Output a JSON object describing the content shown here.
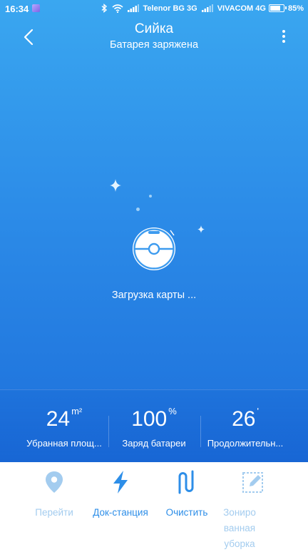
{
  "status_bar": {
    "time": "16:34",
    "carrier1": "Telenor BG 3G",
    "carrier2": "VIVACOM 4G",
    "battery": "85%",
    "battery_level": 0.85
  },
  "header": {
    "title": "Сийка",
    "subtitle": "Батарея заряжена"
  },
  "map": {
    "loading_text": "Загрузка карты ..."
  },
  "stats": [
    {
      "value": "24",
      "unit": "m²",
      "label": "Убранная площ..."
    },
    {
      "value": "100",
      "unit": "%",
      "label": "Заряд батареи"
    },
    {
      "value": "26",
      "unit": "'",
      "label": "Продолжительн..."
    }
  ],
  "bottom_bar": {
    "items": [
      {
        "label": "Перейти",
        "icon": "location-pin-icon",
        "color": "#a3ccef"
      },
      {
        "label": "Док-станция",
        "icon": "lightning-icon",
        "color": "#2d8ee8"
      },
      {
        "label": "Очистить",
        "icon": "clean-path-icon",
        "color": "#2d8ee8"
      },
      {
        "label": "Зониро ванная уборка",
        "icon": "zone-edit-icon",
        "color": "#a3ccef"
      }
    ]
  },
  "colors": {
    "primary_blue": "#2d8ee8",
    "disabled_blue": "#a3ccef",
    "background_top": "#3aa7f0",
    "background_bottom": "#1d6fdb"
  }
}
